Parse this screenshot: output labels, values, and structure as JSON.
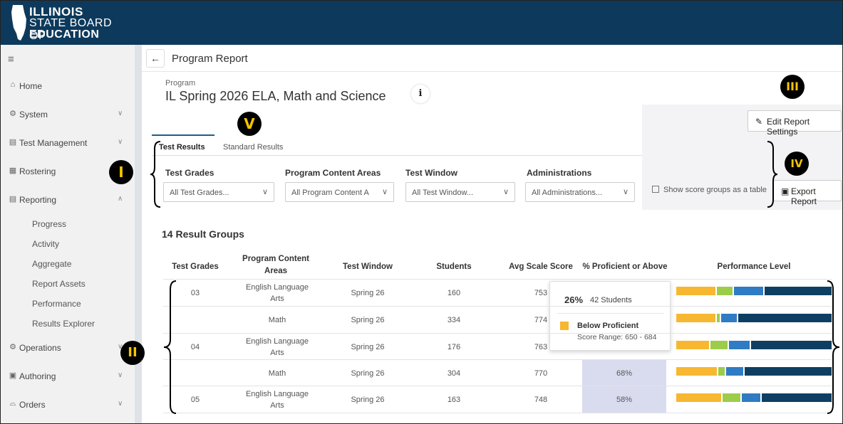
{
  "brand": {
    "line1": "ILLINOIS",
    "line2": "STATE BOARD OF",
    "line3": "EDUCATION",
    "color": "#0d3a5c"
  },
  "sidebar": {
    "menu_icon": "hamburger-icon",
    "items": [
      {
        "label": "Home",
        "icon": "home-icon"
      },
      {
        "label": "System",
        "icon": "gear-icon"
      },
      {
        "label": "Test Management",
        "icon": "folder-icon"
      },
      {
        "label": "Rostering",
        "icon": "clipboard-icon"
      },
      {
        "label": "Reporting",
        "icon": "chart-icon"
      },
      {
        "label": "Operations",
        "icon": "cogs-icon"
      },
      {
        "label": "Authoring",
        "icon": "book-icon"
      },
      {
        "label": "Orders",
        "icon": "cart-icon"
      }
    ],
    "reporting_sub": [
      "Progress",
      "Activity",
      "Aggregate",
      "Report Assets",
      "Performance",
      "Results Explorer"
    ]
  },
  "header": {
    "back_icon": "←",
    "title": "Program Report"
  },
  "program": {
    "label": "Program",
    "title": "IL Spring 2026 ELA, Math and Science",
    "info_icon": "i"
  },
  "actions": {
    "edit_label": "Edit Report Settings",
    "export_label": "Export Report",
    "show_table_label": "Show score groups as a table"
  },
  "tabs": [
    "Test Results",
    "Standard Results"
  ],
  "filters": [
    {
      "label": "Test Grades",
      "value": "All Test Grades..."
    },
    {
      "label": "Program Content Areas",
      "value": "All Program Content A"
    },
    {
      "label": "Test Window",
      "value": "All Test Window..."
    },
    {
      "label": "Administrations",
      "value": "All Administrations..."
    }
  ],
  "result_count": "14 Result Groups",
  "table": {
    "headers": [
      "Test Grades",
      "Program Content Areas",
      "Test Window",
      "Students",
      "Avg Scale Score",
      "% Proficient or Above",
      "Performance Level"
    ],
    "rows": [
      {
        "grade": "03",
        "area": "English Language Arts",
        "window": "Spring 26",
        "students": "160",
        "avg": "753",
        "pct": "",
        "levels": [
          0.26,
          0.11,
          0.2,
          0.43
        ]
      },
      {
        "grade": "",
        "area": "Math",
        "window": "Spring 26",
        "students": "334",
        "avg": "774",
        "pct": "",
        "levels": [
          0.26,
          0.03,
          0.11,
          0.6
        ]
      },
      {
        "grade": "04",
        "area": "English Language Arts",
        "window": "Spring 26",
        "students": "176",
        "avg": "763",
        "pct": "",
        "levels": [
          0.22,
          0.12,
          0.14,
          0.52
        ]
      },
      {
        "grade": "",
        "area": "Math",
        "window": "Spring 26",
        "students": "304",
        "avg": "770",
        "pct": "68%",
        "levels": [
          0.27,
          0.05,
          0.12,
          0.56
        ]
      },
      {
        "grade": "05",
        "area": "English Language Arts",
        "window": "Spring 26",
        "students": "163",
        "avg": "748",
        "pct": "58%",
        "levels": [
          0.3,
          0.12,
          0.13,
          0.45
        ]
      }
    ]
  },
  "level_colors": [
    "#f7b731",
    "#9ccc4a",
    "#2f7bc4",
    "#0e3f62"
  ],
  "tooltip": {
    "pct": "26%",
    "students": "42 Students",
    "level": "Below Proficient",
    "range": "Score Range: 650 - 684"
  },
  "callouts": [
    "I",
    "II",
    "III",
    "IV",
    "V"
  ]
}
